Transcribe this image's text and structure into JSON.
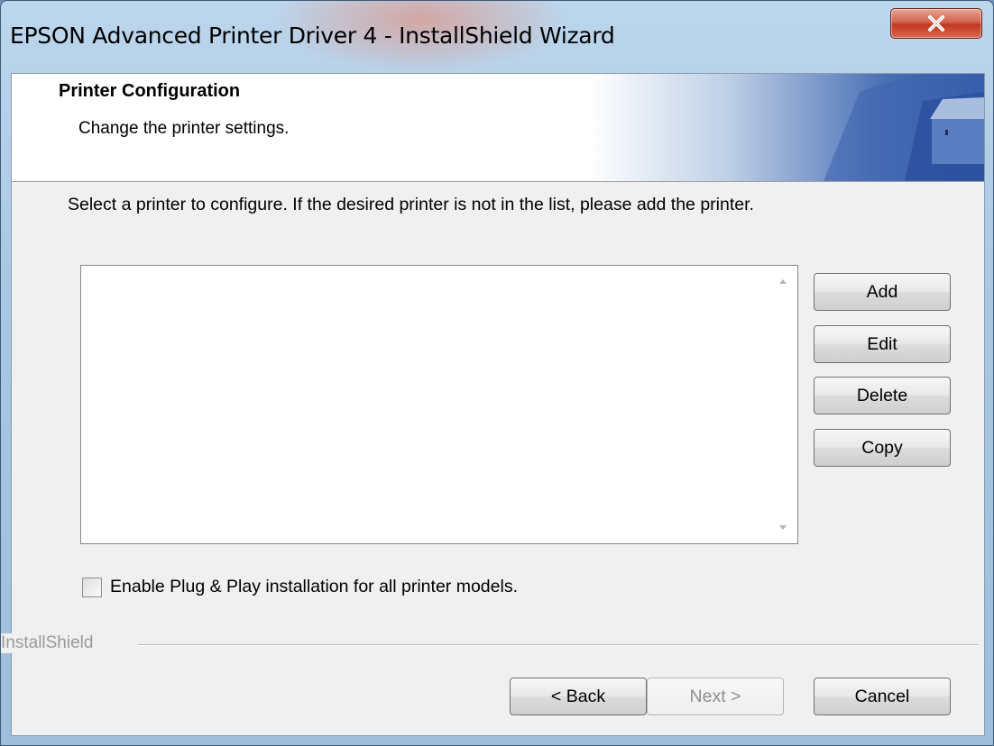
{
  "window": {
    "title": "EPSON Advanced Printer Driver 4 - InstallShield Wizard",
    "close_icon": "close-icon"
  },
  "header": {
    "title": "Printer Configuration",
    "subtitle": "Change the printer settings."
  },
  "main": {
    "instruction": "Select a printer to configure. If the desired printer is not in the list, please add the printer.",
    "printer_list": [],
    "side_buttons": {
      "add": "Add",
      "edit": "Edit",
      "delete": "Delete",
      "copy": "Copy"
    },
    "checkbox": {
      "label": "Enable Plug & Play installation for all printer models.",
      "checked": false
    }
  },
  "footer": {
    "brand": "InstallShield",
    "back": "< Back",
    "next": "Next >",
    "cancel": "Cancel"
  },
  "colors": {
    "close_button": "#c1381f",
    "header_art": "#2e56a5"
  }
}
